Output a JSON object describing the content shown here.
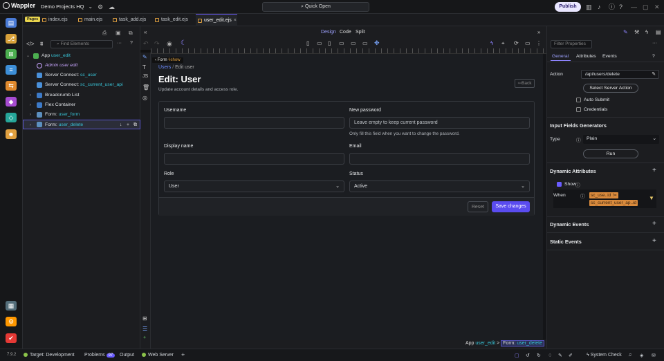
{
  "app": {
    "logo_text": "Wappler",
    "project": "Demo Projects HQ",
    "quick_open": "Quick Open",
    "publish": "Publish",
    "version": "7.9.2"
  },
  "tabs": {
    "pages_badge": "Pages",
    "items": [
      {
        "label": "index.ejs"
      },
      {
        "label": "main.ejs"
      },
      {
        "label": "task_add.ejs"
      },
      {
        "label": "task_edit.ejs"
      },
      {
        "label": "user_edit.ejs"
      }
    ],
    "close": "×"
  },
  "tree": {
    "find_placeholder": "Find Elements",
    "app": {
      "label": "App",
      "id": "user_edit"
    },
    "nodes": [
      {
        "label": "Admin user edit",
        "extra": ""
      },
      {
        "label": "Server Connect:",
        "extra": "sc_user"
      },
      {
        "label": "Server Connect:",
        "extra": "sc_current_user_api"
      },
      {
        "label": "Breadcrumb List",
        "extra": ""
      },
      {
        "label": "Flex Container",
        "extra": ""
      },
      {
        "label": "Form:",
        "extra": "user_form"
      },
      {
        "label": "Form:",
        "extra": "user_delete"
      }
    ]
  },
  "view_modes": {
    "design": "Design",
    "code": "Code",
    "split": "Split"
  },
  "preview": {
    "tag": {
      "label": "Form",
      "flag": "show"
    },
    "breadcrumb": {
      "parent": "Users",
      "sep": "/",
      "current": "Edit user"
    },
    "title": "Edit: User",
    "subtitle": "Update account details and access role.",
    "back": "Back",
    "form": {
      "username": {
        "label": "Username",
        "value": ""
      },
      "password": {
        "label": "New password",
        "placeholder": "Leave empty to keep current password",
        "hint": "Only fill this field when you want to change the password."
      },
      "display_name": {
        "label": "Display name",
        "value": ""
      },
      "email": {
        "label": "Email",
        "value": ""
      },
      "role": {
        "label": "Role",
        "value": "User"
      },
      "status": {
        "label": "Status",
        "value": "Active"
      },
      "reset": "Reset",
      "save": "Save changes"
    }
  },
  "bottom_crumb": {
    "app": "App",
    "app_id": "user_edit",
    "sep": ">",
    "form": "Form:",
    "form_id": "user_delete"
  },
  "props": {
    "placeholder": "Filter Properties",
    "tabs": [
      "General",
      "Attributes",
      "Events"
    ],
    "action_label": "Action",
    "action_value": "/api/users/delete",
    "select_action": "Select Server Action",
    "auto_submit": "Auto Submit",
    "credentials": "Credentials",
    "inputs_title": "Input Fields Generators",
    "type_label": "Type",
    "type_value": "Plain",
    "run": "Run",
    "dyn_attr": "Dynamic Attributes",
    "show_label": "Show",
    "when_label": "When",
    "when_tokens": [
      "sc_use..id",
      "!=",
      "sc_current_user_ap..id"
    ],
    "dyn_events": "Dynamic Events",
    "static_events": "Static Events"
  },
  "status": {
    "target": "Target:",
    "target_value": "Development",
    "problems": "Problems",
    "problems_count": "97",
    "output": "Output",
    "web_server": "Web Server",
    "system_check": "System Check"
  },
  "colors": {
    "accent": "#6a5cff",
    "teal": "#38c5d8",
    "token": "#d98a3c",
    "save": "#5a4cf0"
  }
}
